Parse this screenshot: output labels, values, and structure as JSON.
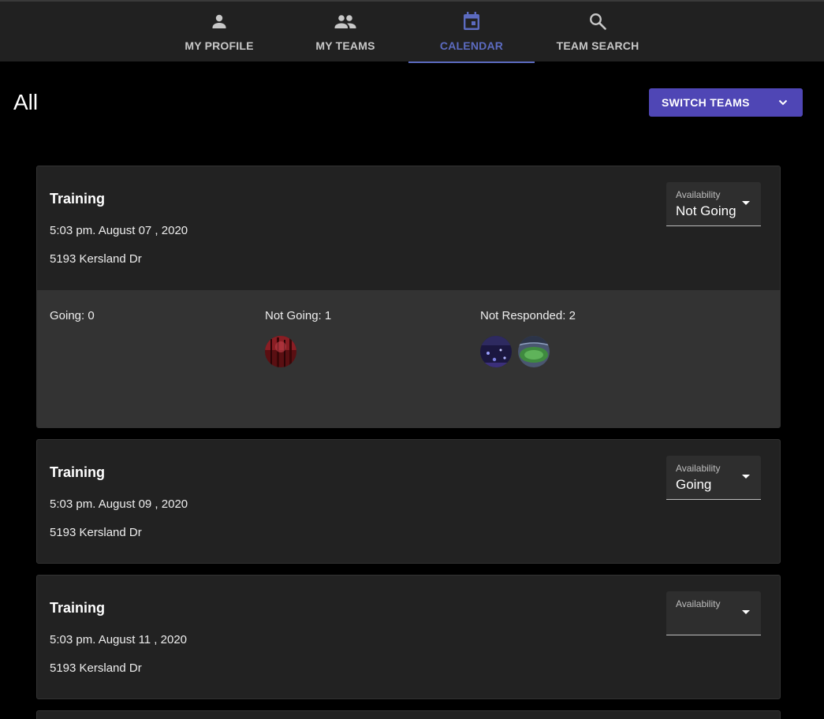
{
  "nav": {
    "tabs": [
      {
        "label": "MY PROFILE",
        "icon": "person-icon"
      },
      {
        "label": "MY TEAMS",
        "icon": "people-icon"
      },
      {
        "label": "CALENDAR",
        "icon": "calendar-icon"
      },
      {
        "label": "TEAM SEARCH",
        "icon": "search-icon"
      }
    ],
    "active_index": 2
  },
  "page": {
    "title": "All",
    "switch_label": "SWITCH TEAMS"
  },
  "events": [
    {
      "title": "Training",
      "date": "5:03 pm. August 07 , 2020",
      "location": "5193 Kersland Dr",
      "availability_label": "Availability",
      "availability_value": "Not Going",
      "responses": {
        "going": "Going: 0",
        "not_going": "Not Going: 1",
        "not_responded": "Not Responded: 2"
      }
    },
    {
      "title": "Training",
      "date": "5:03 pm. August 09 , 2020",
      "location": "5193 Kersland Dr",
      "availability_label": "Availability",
      "availability_value": "Going"
    },
    {
      "title": "Training",
      "date": "5:03 pm. August 11 , 2020",
      "location": "5193 Kersland Dr",
      "availability_label": "Availability",
      "availability_value": ""
    }
  ],
  "colors": {
    "accent": "#5c6bc0",
    "button": "#4f46b5",
    "card": "#222222",
    "response_panel": "#333333"
  }
}
